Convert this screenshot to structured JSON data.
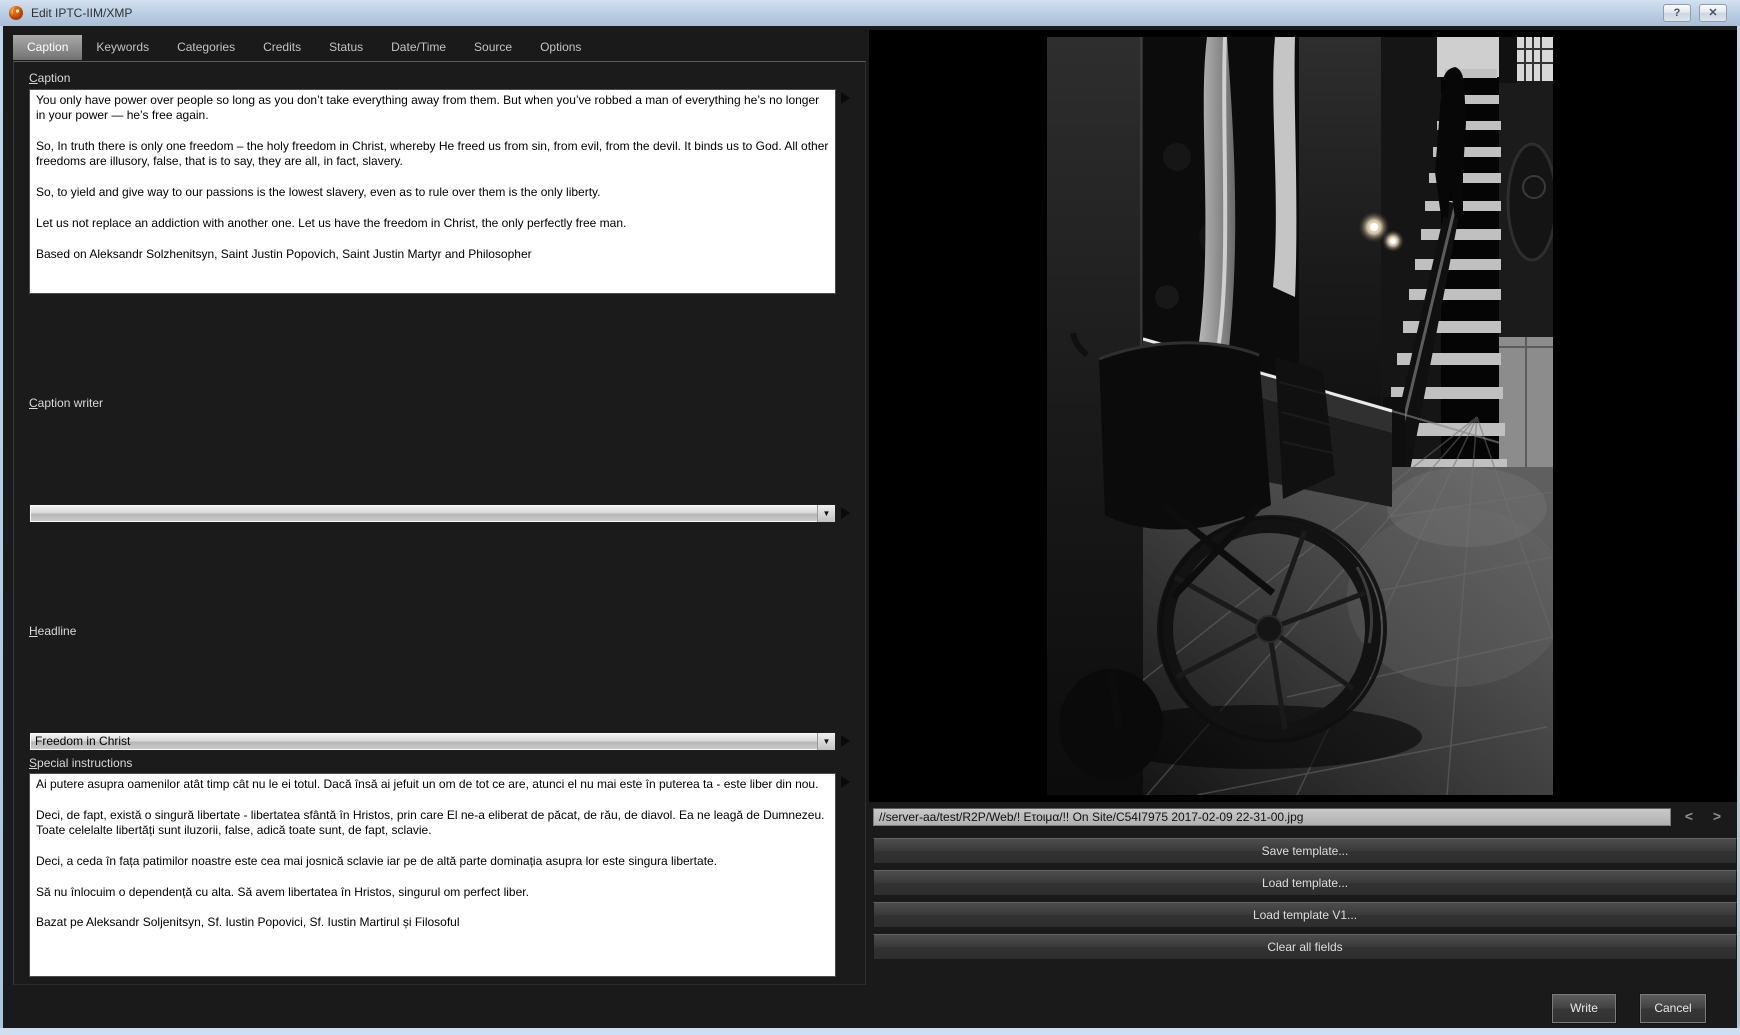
{
  "window": {
    "title": "Edit IPTC-IIM/XMP",
    "help": "?",
    "close": "✕"
  },
  "tabs": [
    {
      "label": "Caption",
      "active": true
    },
    {
      "label": "Keywords",
      "active": false
    },
    {
      "label": "Categories",
      "active": false
    },
    {
      "label": "Credits",
      "active": false
    },
    {
      "label": "Status",
      "active": false
    },
    {
      "label": "Date/Time",
      "active": false
    },
    {
      "label": "Source",
      "active": false
    },
    {
      "label": "Options",
      "active": false
    }
  ],
  "fields": {
    "caption": {
      "label_mn": "C",
      "label_rest": "aption",
      "value": "You only have power over people so long as you don’t take everything away from them. But when you’ve robbed a man of everything he’s no longer in your power — he’s free again.\n\nSo, In truth there is only one freedom – the holy freedom in Christ, whereby He freed us from sin, from evil, from the devil. It binds us to God. All other freedoms are illusory, false, that is to say, they are all, in fact, slavery.\n\nSo, to yield and give way to our passions is the lowest slavery, even as to rule over them is the only liberty.\n\nLet us not replace an addiction with another one. Let us have the freedom in Christ, the only perfectly free man.\n\nBased on Aleksandr Solzhenitsyn, Saint Justin Popovich, Saint Justin Martyr and Philosopher"
    },
    "caption_writer": {
      "label_mn": "C",
      "label_rest": "aption writer",
      "value": ""
    },
    "headline": {
      "label_mn": "H",
      "label_rest": "eadline",
      "value": "Freedom in Christ"
    },
    "special_instructions": {
      "label_mn": "S",
      "label_rest": "pecial instructions",
      "value": "Ai putere asupra oamenilor atât timp cât nu le ei totul. Dacă însă ai jefuit un om de tot ce are, atunci el nu mai este în puterea ta - este liber din nou.\n\nDeci, de fapt, există o singură libertate - libertatea sfântă în Hristos, prin care El ne-a eliberat de păcat, de rău, de diavol. Ea ne leagă de Dumnezeu. Toate celelalte libertăți sunt iluzorii, false, adică toate sunt, de fapt, sclavie.\n\nDeci, a ceda în fața patimilor noastre este cea mai josnică sclavie iar pe de altă parte dominația asupra lor este singura libertate.\n\nSă nu înlocuim o dependență cu alta. Să avem libertatea în Hristos, singurul om perfect liber.\n\nBazat pe Aleksandr Soljenitsyn, Sf. Iustin Popovici, Sf. Iustin Martirul și Filosoful"
    }
  },
  "combo_arrow": "▼",
  "image_panel": {
    "path": "//server-aa/test/R2P/Web/! Ετοιμα/!! On Site/C54I7975 2017-02-09 22-31-00.jpg",
    "prev": "<",
    "next": ">",
    "buttons": [
      "Save template...",
      "Load template...",
      "Load template V1...",
      "Clear all fields"
    ]
  },
  "footer": {
    "write": "Write",
    "cancel": "Cancel"
  },
  "colors": {
    "titlebar": "#b7cbe2",
    "dialog_bg": "#1a1a1a",
    "field_bg": "#ffffff",
    "combo_silver": "#cdcdcd",
    "button_dark": "#3a3a3a",
    "app_icon_orange": "#e8731a"
  }
}
